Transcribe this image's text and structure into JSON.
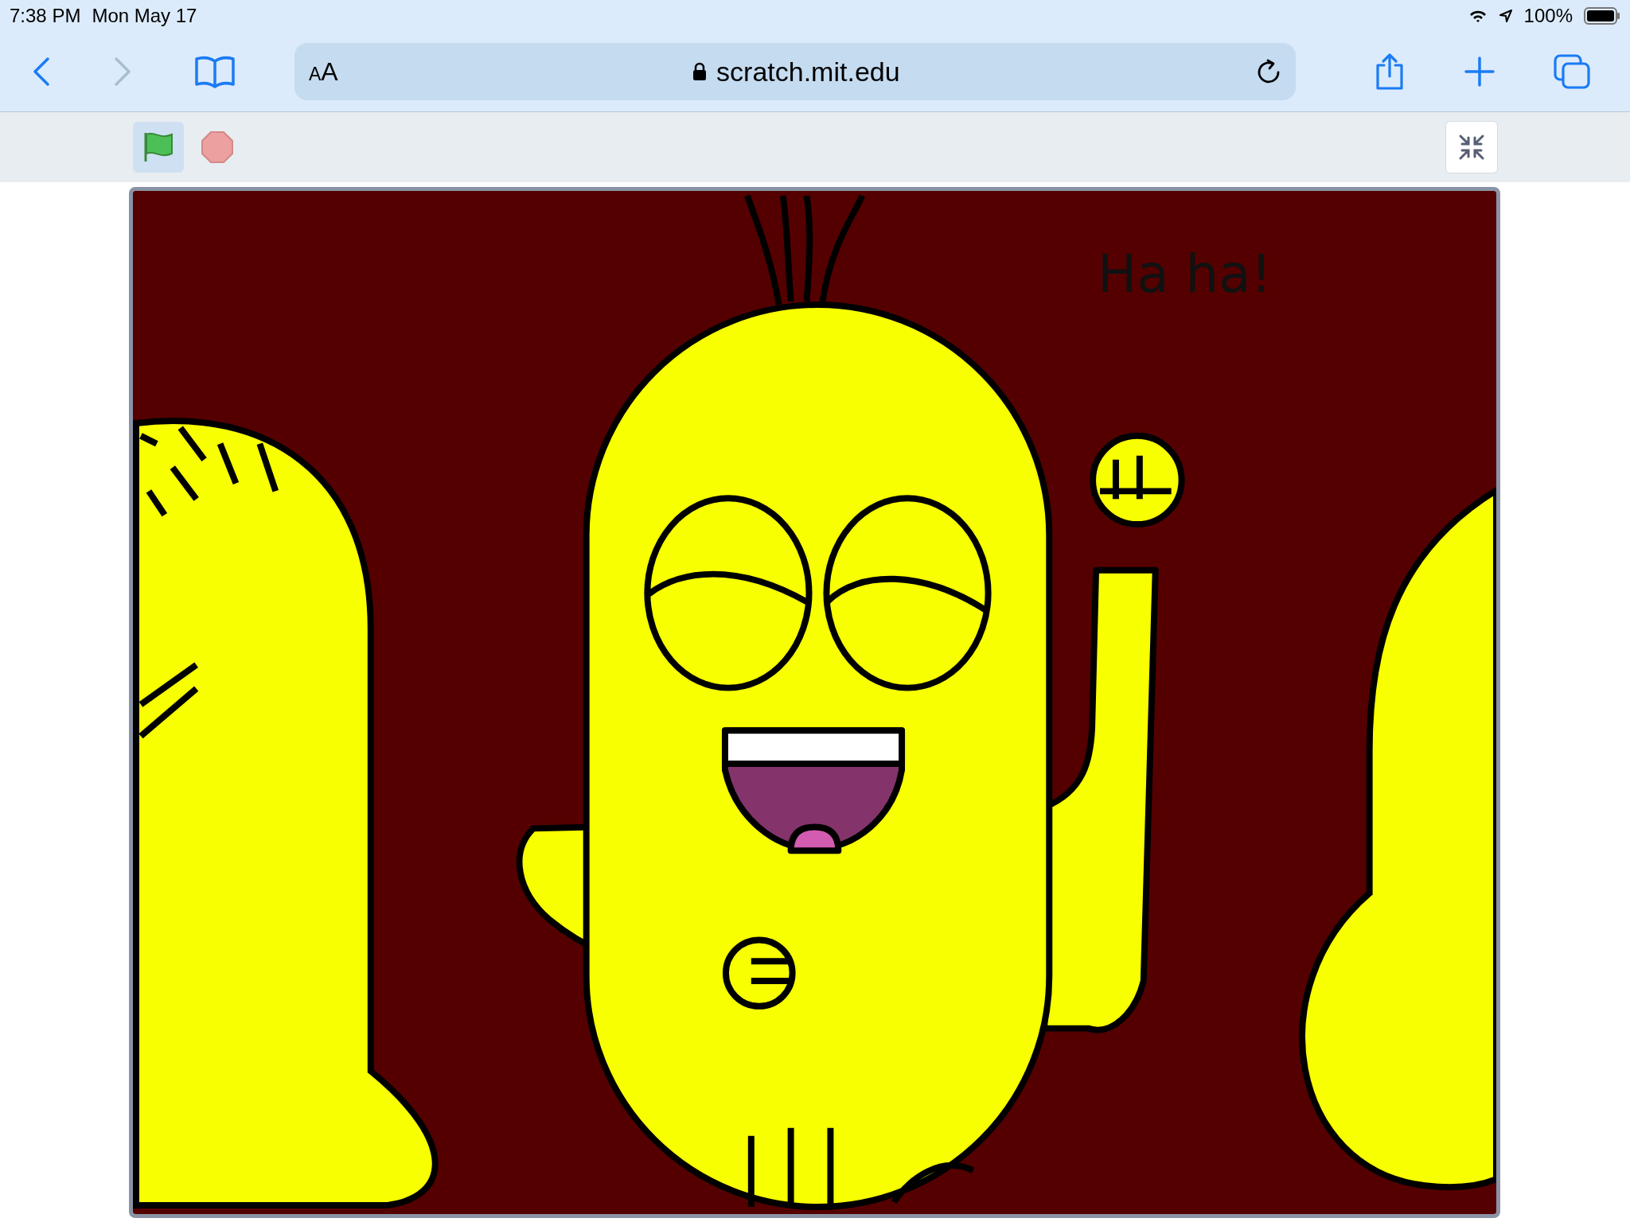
{
  "status_bar": {
    "time": "7:38 PM",
    "date": "Mon May 17",
    "battery": "100%"
  },
  "toolbar": {
    "text_size_button": "AA",
    "url": "scratch.mit.edu"
  },
  "player_controls": {
    "green_flag": {
      "selected": true
    }
  },
  "stage": {
    "text": "Ha ha!"
  }
}
